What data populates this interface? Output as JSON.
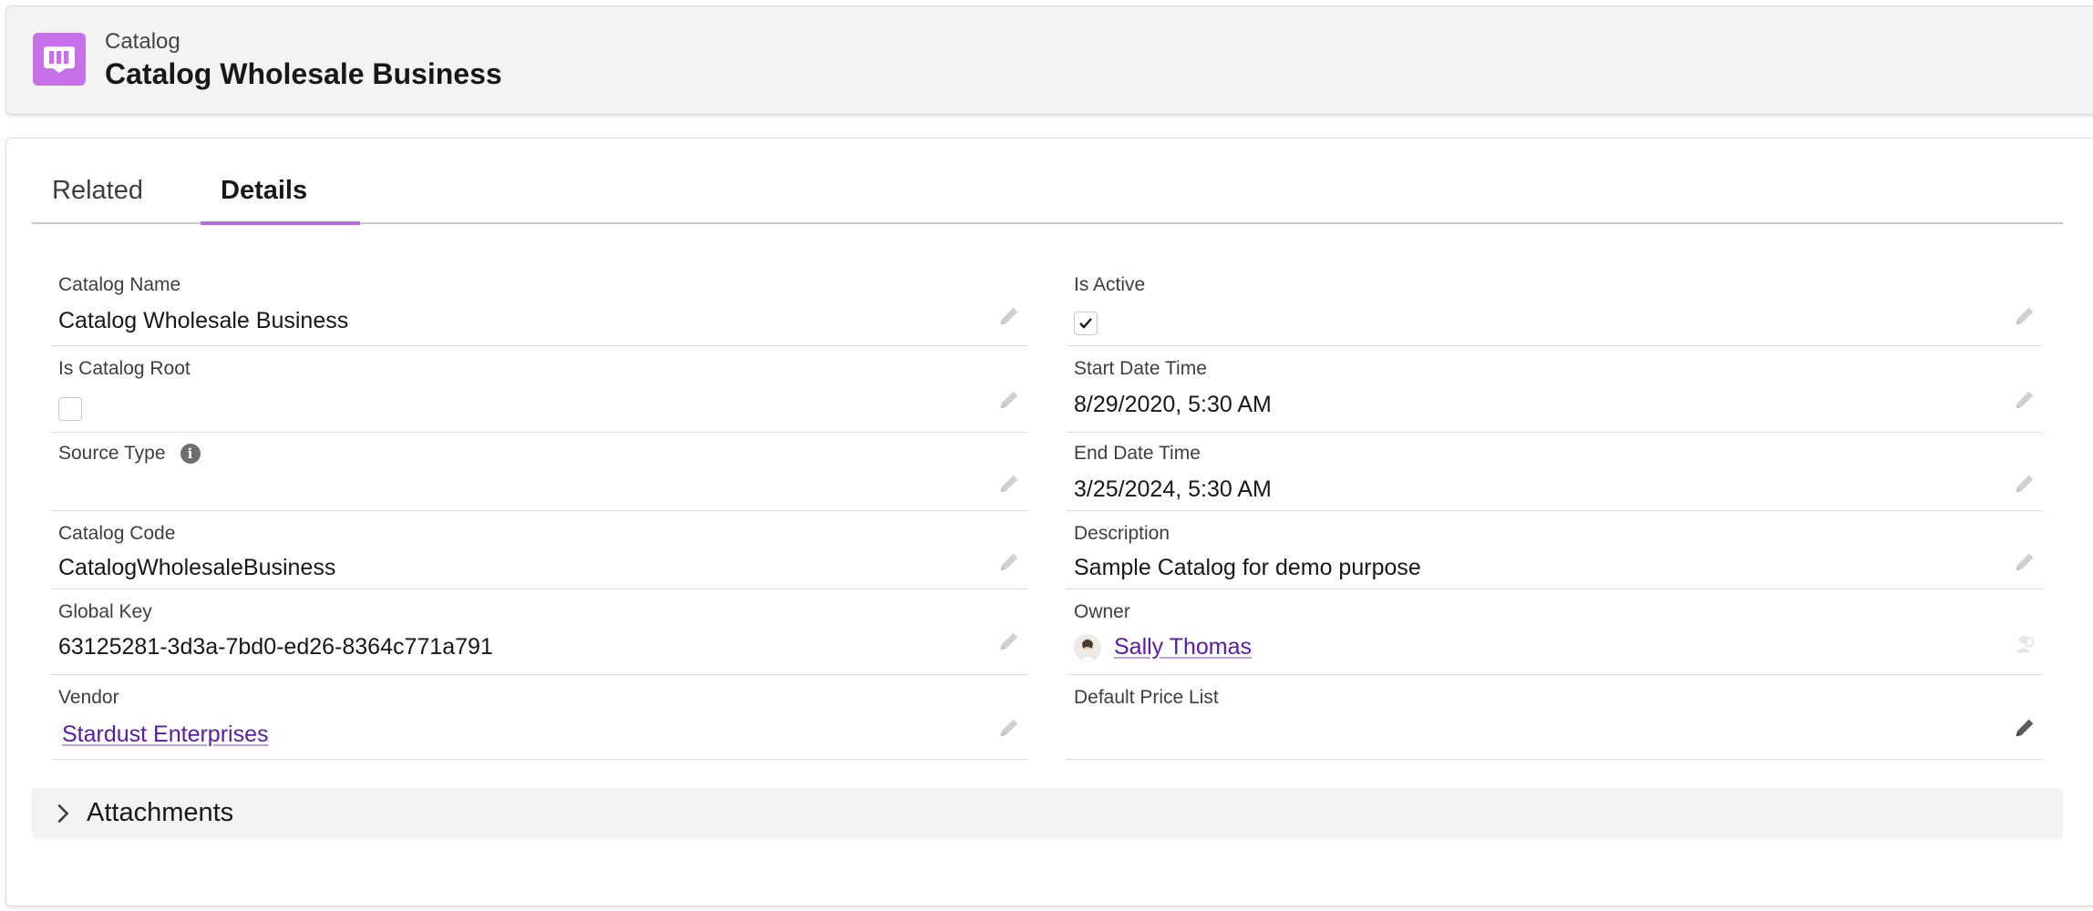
{
  "header": {
    "object_label": "Catalog",
    "record_title": "Catalog Wholesale Business",
    "icon": "catalog-book-icon",
    "icon_color": "#c770e8"
  },
  "tabs": [
    {
      "label": "Related",
      "active": false
    },
    {
      "label": "Details",
      "active": true
    }
  ],
  "accent_color": "#b170e0",
  "link_color": "#5a1ba9",
  "fields": {
    "catalog_name": {
      "label": "Catalog Name",
      "value": "Catalog Wholesale Business"
    },
    "is_active": {
      "label": "Is Active",
      "checked": true
    },
    "is_catalog_root": {
      "label": "Is Catalog Root",
      "checked": false
    },
    "start_date_time": {
      "label": "Start Date Time",
      "value": "8/29/2020, 5:30 AM"
    },
    "source_type": {
      "label": "Source Type",
      "value": ""
    },
    "end_date_time": {
      "label": "End Date Time",
      "value": "3/25/2024, 5:30 AM"
    },
    "catalog_code": {
      "label": "Catalog Code",
      "value": "CatalogWholesaleBusiness"
    },
    "description": {
      "label": "Description",
      "value": "Sample Catalog for demo purpose"
    },
    "global_key": {
      "label": "Global Key",
      "value": "63125281-3d3a-7bd0-ed26-8364c771a791"
    },
    "owner": {
      "label": "Owner",
      "value": "Sally Thomas"
    },
    "vendor": {
      "label": "Vendor",
      "value": "Stardust Enterprises"
    },
    "default_price_list": {
      "label": "Default Price List",
      "value": ""
    }
  },
  "sections": [
    {
      "title": "Attachments",
      "expanded": false
    }
  ]
}
